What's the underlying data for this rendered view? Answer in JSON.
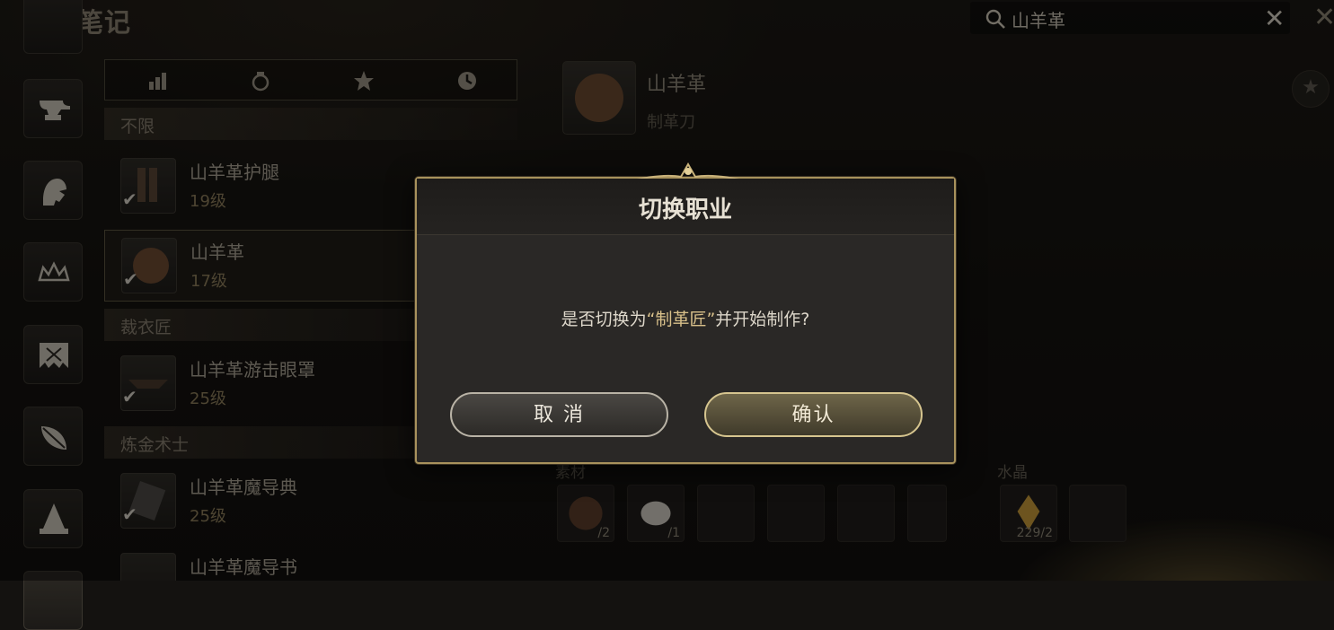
{
  "header": {
    "title": "制作笔记",
    "search_value": "山羊革"
  },
  "filter_tabs": [
    "level-icon",
    "bag-icon",
    "star-icon",
    "clock-icon"
  ],
  "list": {
    "sections": [
      {
        "title": "不限"
      },
      {
        "title": "裁衣匠"
      },
      {
        "title": "炼金术士"
      }
    ],
    "items": [
      {
        "name": "山羊革护腿",
        "level": "19级"
      },
      {
        "name": "山羊革",
        "level": "17级"
      },
      {
        "name": "山羊革游击眼罩",
        "level": "25级"
      },
      {
        "name": "山羊革魔导典",
        "level": "25级"
      },
      {
        "name": "山羊革魔导书"
      }
    ]
  },
  "detail": {
    "name": "山羊革",
    "tool": "制革刀",
    "materials_label": "素材",
    "crystals_label": "水晶",
    "materials": [
      {
        "count": "/2"
      },
      {
        "count": "/1"
      }
    ],
    "crystals": [
      {
        "count": "229/2"
      }
    ]
  },
  "dialog": {
    "title": "切换职业",
    "message_prefix": "是否切换为",
    "message_job": "“制革匠”",
    "message_suffix": "并开始制作?",
    "cancel_label": "取 消",
    "confirm_label": "确认"
  }
}
